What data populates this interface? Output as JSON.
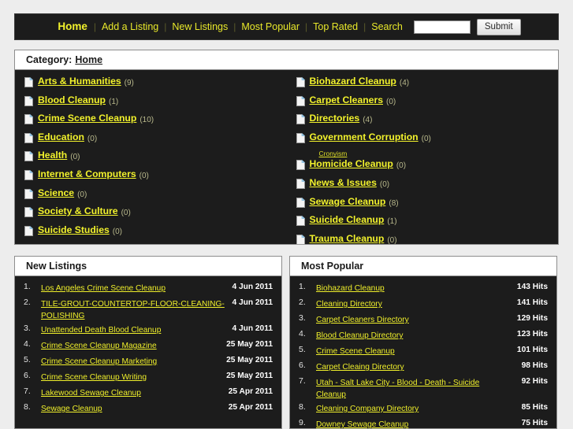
{
  "nav": {
    "links": [
      {
        "label": "Home",
        "active": true
      },
      {
        "label": "Add a Listing",
        "active": false
      },
      {
        "label": "New Listings",
        "active": false
      },
      {
        "label": "Most Popular",
        "active": false
      },
      {
        "label": "Top Rated",
        "active": false
      },
      {
        "label": "Search",
        "active": false
      }
    ],
    "search_value": "",
    "search_placeholder": "",
    "submit_label": "Submit"
  },
  "category_panel": {
    "header_label": "Category:",
    "header_crumb": "Home",
    "left_column": [
      {
        "label": "Arts & Humanities",
        "count": "(9)"
      },
      {
        "label": "Blood Cleanup",
        "count": "(1)"
      },
      {
        "label": "Crime Scene Cleanup",
        "count": "(10)"
      },
      {
        "label": "Education",
        "count": "(0)"
      },
      {
        "label": "Health",
        "count": "(0)"
      },
      {
        "label": "Internet & Computers",
        "count": "(0)"
      },
      {
        "label": "Science",
        "count": "(0)"
      },
      {
        "label": "Society & Culture",
        "count": "(0)"
      },
      {
        "label": "Suicide Studies",
        "count": "(0)"
      }
    ],
    "right_column": [
      {
        "label": "Biohazard Cleanup",
        "count": "(4)"
      },
      {
        "label": "Carpet Cleaners",
        "count": "(0)"
      },
      {
        "label": "Directories",
        "count": "(4)"
      },
      {
        "label": "Government Corruption",
        "count": "(0)",
        "sub": "Cronyism"
      },
      {
        "label": "Homicide Cleanup",
        "count": "(0)"
      },
      {
        "label": "News & Issues",
        "count": "(0)"
      },
      {
        "label": "Sewage Cleanup",
        "count": "(8)"
      },
      {
        "label": "Suicide Cleanup",
        "count": "(1)"
      },
      {
        "label": "Trauma Cleanup",
        "count": "(0)"
      }
    ]
  },
  "new_listings": {
    "title": "New Listings",
    "rows": [
      {
        "idx": "1.",
        "title": "Los Angeles Crime Scene Cleanup",
        "meta": "4 Jun 2011"
      },
      {
        "idx": "2.",
        "title": "TILE-GROUT-COUNTERTOP-FLOOR-CLEANING-POLISHING ",
        "meta": "4 Jun 2011"
      },
      {
        "idx": "3.",
        "title": "Unattended Death Blood Cleanup",
        "meta": "4 Jun 2011"
      },
      {
        "idx": "4.",
        "title": "Crime Scene Cleanup Magazine",
        "meta": "25 May 2011"
      },
      {
        "idx": "5.",
        "title": "Crime Scene Cleanup Marketing",
        "meta": "25 May 2011"
      },
      {
        "idx": "6.",
        "title": "Crime Scene Cleanup Writing",
        "meta": "25 May 2011"
      },
      {
        "idx": "7.",
        "title": "Lakewood Sewage Cleanup",
        "meta": "25 Apr 2011"
      },
      {
        "idx": "8.",
        "title": "Sewage Cleanup",
        "meta": "25 Apr 2011"
      }
    ]
  },
  "most_popular": {
    "title": "Most Popular",
    "rows": [
      {
        "idx": "1.",
        "title": "Biohazard Cleanup",
        "meta": "143 Hits"
      },
      {
        "idx": "2.",
        "title": "Cleaning Directory",
        "meta": "141 Hits"
      },
      {
        "idx": "3.",
        "title": "Carpet Cleaners Directory",
        "meta": "129 Hits"
      },
      {
        "idx": "4.",
        "title": "Blood Cleanup Directory",
        "meta": "123 Hits"
      },
      {
        "idx": "5.",
        "title": "Crime Scene Cleanup",
        "meta": "101 Hits"
      },
      {
        "idx": "6.",
        "title": "Carpet Cleaing Directory",
        "meta": "98 Hits"
      },
      {
        "idx": "7.",
        "title": "Utah - Salt Lake City - Blood - Death - Suicide Cleanup",
        "meta": "92 Hits"
      },
      {
        "idx": "8.",
        "title": "Cleaning Company Directory",
        "meta": "85 Hits"
      },
      {
        "idx": "9.",
        "title": "Downey Sewage Cleanup",
        "meta": "75 Hits"
      }
    ]
  },
  "colors": {
    "page_background": "#ededed",
    "panel_background": "#1c1c1c",
    "link_yellow": "#f2f22c",
    "panel_header_background": "#ffffff",
    "panel_border": "#8d8d8d"
  },
  "icons": {
    "category": "document-page-icon"
  }
}
